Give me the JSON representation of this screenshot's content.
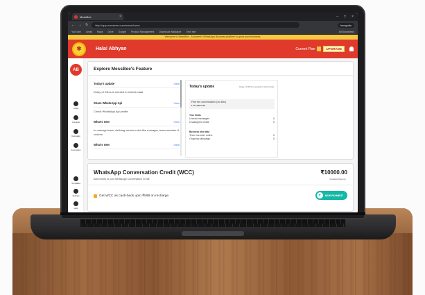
{
  "browser": {
    "tab_title": "MessBee",
    "url": "http://app.messbee.com/mess/home",
    "incognito_label": "Incognito",
    "bookmarks": [
      "YouTube",
      "Gmail",
      "Maps",
      "Drive",
      "Google",
      "Product Management",
      "Download Wallpaper",
      "Tech site"
    ],
    "bookmarks_right": "All Bookmarks"
  },
  "banner": "Welcome to MessBee - A powerful WhatsApp Business platform to grow your business.",
  "header": {
    "greeting": "Hala! Abhyan",
    "plan_label": "Current Plan",
    "upgrade_label": "UPGRADE"
  },
  "sidebar": {
    "avatar_initials": "AB",
    "items": [
      {
        "label": "Chats",
        "icon": "chat-icon"
      },
      {
        "label": "Contacts",
        "icon": "contacts-icon"
      },
      {
        "label": "Campaign",
        "icon": "campaign-icon"
      },
      {
        "label": "Automation",
        "icon": "automation-icon"
      },
      {
        "label": "Templates",
        "icon": "templates-icon"
      },
      {
        "label": "Settings",
        "icon": "settings-icon"
      },
      {
        "label": "Help",
        "icon": "help-icon"
      }
    ]
  },
  "feature": {
    "title": "Explore MessBee's Feature",
    "list": [
      {
        "title": "Today's update",
        "view": "View",
        "body": "Delay of 24hrs is needed to refresh data"
      },
      {
        "title": "Share WhatsApp Api",
        "view": "View",
        "body": "Check WhatsApp Api profile"
      },
      {
        "title": "What's new",
        "view": "View",
        "body": "In manage team, defining various roles like manager, team member & custom."
      },
      {
        "title": "What's new",
        "view": "View",
        "body": ""
      }
    ]
  },
  "update": {
    "title": "Today's update",
    "delay": "Delay of 24hrs is needed to refresh data",
    "free_tier_label": "Free tier conversation (1st Dec)",
    "free_tier_value": "1 of 1,000 used",
    "your_chats_heading": "Your Chats",
    "unread_label": "Unread messages",
    "unread_value": "0",
    "unassigned_label": "Unassigned chats",
    "unassigned_value": "0",
    "business_heading": "Business who data",
    "team_online_label": "Team member online",
    "team_online_value": "0",
    "ongoing_label": "Ongoing campaign",
    "ongoing_value": "0"
  },
  "wcc": {
    "title": "WhatsApp Conversation Credit (WCC)",
    "subtitle": "Add money to your WhatsApp Conversation Credit",
    "amount": "₹10000.00",
    "amount_sub": "(Available Balance)",
    "cashback": "Get WCC as cash-back upto ₹599 on recharge.",
    "new_payment": "NEW PAYMENT"
  }
}
